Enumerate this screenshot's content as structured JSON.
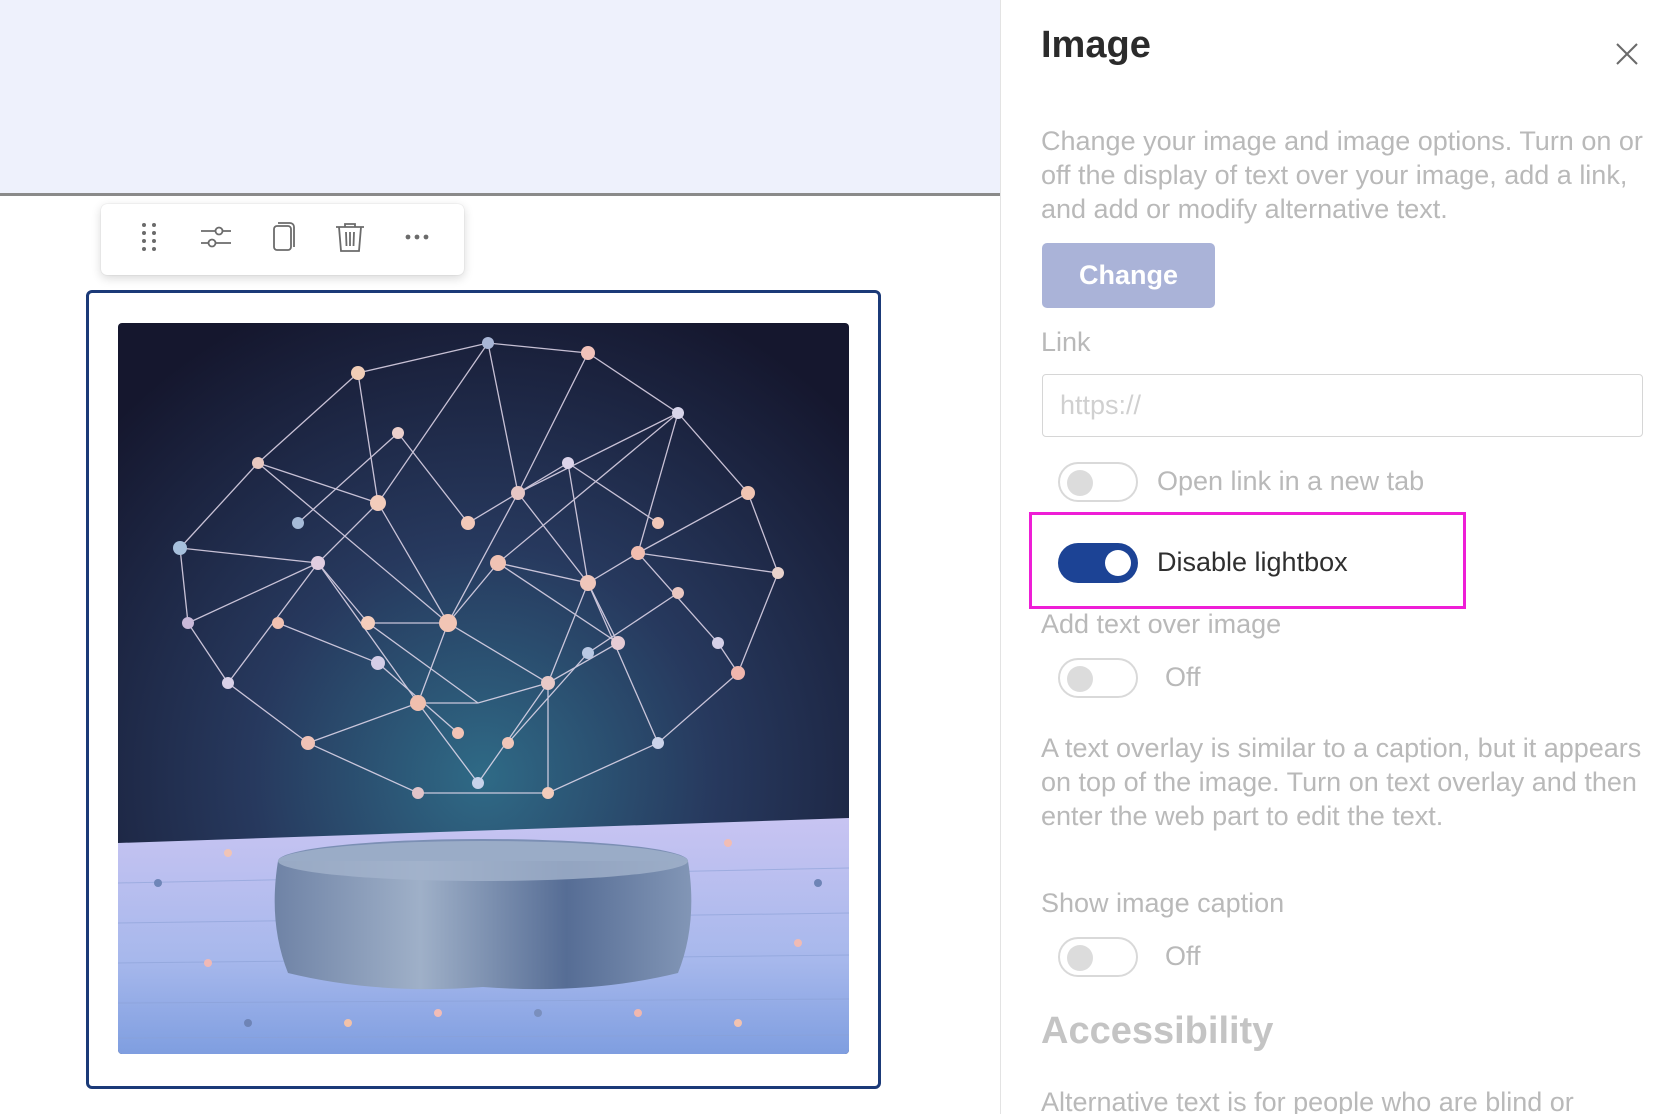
{
  "canvas": {
    "toolbar": {
      "buttons": [
        {
          "name": "drag-handle",
          "icon": "drag-handle-icon"
        },
        {
          "name": "edit-properties",
          "icon": "sliders-icon"
        },
        {
          "name": "duplicate",
          "icon": "copy-icon"
        },
        {
          "name": "delete",
          "icon": "trash-icon"
        },
        {
          "name": "more",
          "icon": "more-horizontal-icon"
        }
      ]
    },
    "image": {
      "frame_color": "#1b3a78"
    }
  },
  "pane": {
    "title": "Image",
    "close_icon": "close-icon",
    "description": "Change your image and image options. Turn on or off the display of text over your image, add a link, and add or modify alternative text.",
    "change_button": "Change",
    "link": {
      "label": "Link",
      "placeholder": "https://",
      "value": ""
    },
    "open_new_tab": {
      "label": "Open link in a new tab",
      "on": false
    },
    "disable_lightbox": {
      "label": "Disable lightbox",
      "on": true,
      "highlight_color": "#ee1ed6"
    },
    "text_over_image": {
      "label": "Add text over image",
      "state_text": "Off",
      "on": false,
      "help": "A text overlay is similar to a caption, but it appears on top of the image. Turn on text overlay and then enter the web part to edit the text."
    },
    "caption": {
      "label": "Show image caption",
      "state_text": "Off",
      "on": false
    },
    "accessibility": {
      "heading": "Accessibility",
      "help": "Alternative text is for people who are blind or"
    },
    "accent_color": "#1c4395"
  }
}
